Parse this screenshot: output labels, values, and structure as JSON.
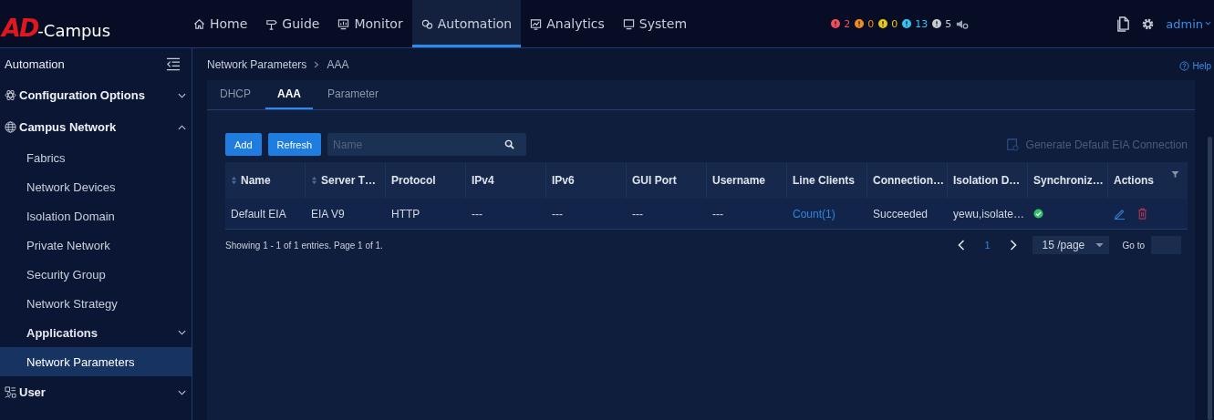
{
  "header": {
    "logo_mark": "AD",
    "logo_text": "-Campus",
    "nav": [
      {
        "label": "Home",
        "selected": false
      },
      {
        "label": "Guide",
        "selected": false
      },
      {
        "label": "Monitor",
        "selected": false
      },
      {
        "label": "Automation",
        "selected": true
      },
      {
        "label": "Analytics",
        "selected": false
      },
      {
        "label": "System",
        "selected": false
      }
    ],
    "alerts": [
      {
        "color": "#f0505a",
        "count": "2"
      },
      {
        "color": "#f08c1e",
        "count": "0"
      },
      {
        "color": "#e6c619",
        "count": "0"
      },
      {
        "color": "#35c4f0",
        "count": "13"
      },
      {
        "color": "#c8cdd4",
        "count": "5"
      }
    ],
    "user": "admin"
  },
  "sidebar": {
    "title": "Automation",
    "items": [
      {
        "label": "Configuration Options",
        "expanded": false
      },
      {
        "label": "Campus Network",
        "expanded": true,
        "children": [
          {
            "label": "Fabrics",
            "kind": "page",
            "selected": false
          },
          {
            "label": "Network Devices",
            "kind": "page",
            "selected": false
          },
          {
            "label": "Isolation Domain",
            "kind": "page",
            "selected": false
          },
          {
            "label": "Private Network",
            "kind": "page",
            "selected": false
          },
          {
            "label": "Security Group",
            "kind": "page",
            "selected": false
          },
          {
            "label": "Network Strategy",
            "kind": "page",
            "selected": false
          },
          {
            "label": "Applications",
            "kind": "group",
            "selected": false,
            "expanded": false
          },
          {
            "label": "Network Parameters",
            "kind": "page",
            "selected": true
          }
        ]
      },
      {
        "label": "User",
        "expanded": false
      }
    ]
  },
  "breadcrumb": [
    "Network Parameters",
    "AAA"
  ],
  "help": "Help",
  "tabs": [
    {
      "label": "DHCP",
      "selected": false
    },
    {
      "label": "AAA",
      "selected": true
    },
    {
      "label": "Parameter",
      "selected": false
    }
  ],
  "toolbar": {
    "buttons": [
      "Add",
      "Refresh"
    ],
    "search": {
      "placeholder": "Name"
    },
    "generate": {
      "label": "Generate Default EIA Connection",
      "disabled": true
    }
  },
  "table": {
    "columns": [
      {
        "label": "Name",
        "sortable": true
      },
      {
        "label": "Server T…",
        "sortable": true
      },
      {
        "label": "Protocol",
        "sortable": false
      },
      {
        "label": "IPv4",
        "sortable": false
      },
      {
        "label": "IPv6",
        "sortable": false
      },
      {
        "label": "GUI Port",
        "sortable": false
      },
      {
        "label": "Username",
        "sortable": false
      },
      {
        "label": "Line Clients",
        "sortable": false
      },
      {
        "label": "Connection…",
        "sortable": false
      },
      {
        "label": "Isolation D…",
        "sortable": false
      },
      {
        "label": "Synchroniz…",
        "sortable": false
      },
      {
        "label": "Actions",
        "sortable": false
      }
    ],
    "rows": [
      {
        "cells": [
          "Default EIA",
          "EIA V9",
          "HTTP",
          "---",
          "---",
          "---",
          "---"
        ],
        "line_clients": "Count(1)",
        "connection": "Succeeded",
        "isolation_domain": "yewu,isolate…",
        "synchronized": true
      }
    ]
  },
  "footer": {
    "summary": "Showing 1 - 1 of 1 entries. Page 1 of 1.",
    "pages": [
      {
        "label": "1",
        "selected": true
      }
    ],
    "page_size": "15 /page",
    "goto": "Go to"
  }
}
